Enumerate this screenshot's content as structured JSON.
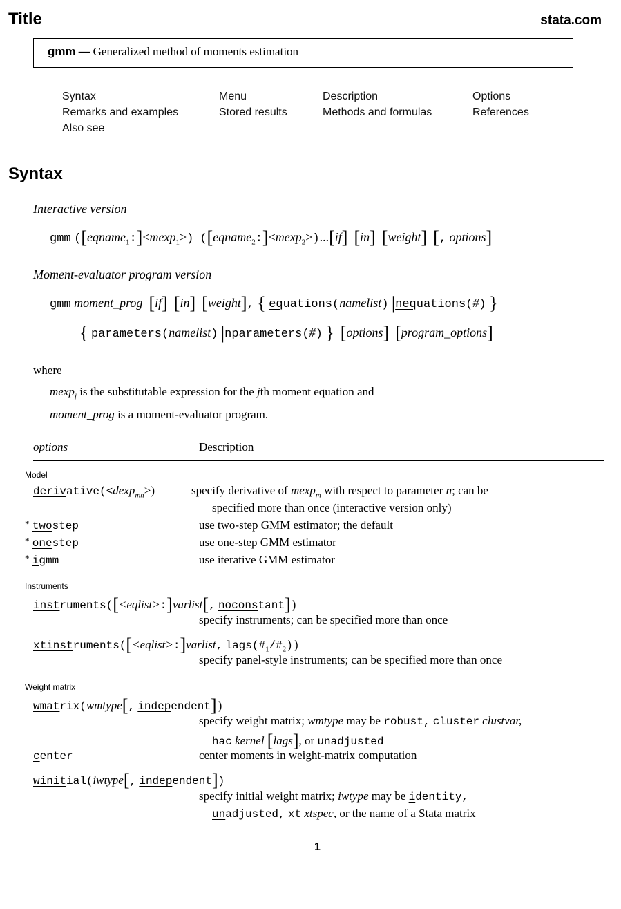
{
  "header": {
    "title": "Title",
    "site": "stata.com"
  },
  "title_box": {
    "command": "gmm",
    "dash": "—",
    "description": "Generalized method of moments estimation"
  },
  "nav_links": [
    {
      "label": "Syntax"
    },
    {
      "label": "Menu"
    },
    {
      "label": "Description"
    },
    {
      "label": "Options"
    },
    {
      "label": "Remarks and examples"
    },
    {
      "label": "Stored results"
    },
    {
      "label": "Methods and formulas"
    },
    {
      "label": "References"
    },
    {
      "label": "Also see"
    }
  ],
  "syntax": {
    "heading": "Syntax",
    "interactive": {
      "label": "Interactive version",
      "cmd": "gmm",
      "eqname1": "eqname",
      "mexp1": "mexp",
      "eqname2": "eqname",
      "mexp2": "mexp",
      "sub1": "1",
      "sub2": "2",
      "ellipsis": "...",
      "if": "if",
      "in": "in",
      "weight": "weight",
      "options": "options"
    },
    "program": {
      "label": "Moment-evaluator program version",
      "cmd": "gmm",
      "moment_prog": "moment_prog",
      "if": "if",
      "in": "in",
      "weight": "weight",
      "eq_ul": "eq",
      "eq_rest": "uations(",
      "namelist": "namelist",
      "neq_ul": "neq",
      "neq_rest": "uations(",
      "hash": "#",
      "param_ul": "param",
      "param_rest": "eters(",
      "nparam_ul": "nparam",
      "nparam_rest": "eters(",
      "options": "options",
      "program_options": "program_options"
    },
    "where": {
      "label": "where",
      "line1_term": "mexp",
      "line1_sub": "j",
      "line1_a": "is the substitutable expression for the",
      "line1_j": "j",
      "line1_b": "th moment equation and",
      "line2_term": "moment_prog",
      "line2_text": "is a moment-evaluator program."
    }
  },
  "options_table": {
    "col1": "options",
    "col2": "Description",
    "groups": [
      {
        "label": "Model"
      },
      {
        "label": "Instruments"
      },
      {
        "label": "Weight matrix"
      }
    ],
    "rows": {
      "derivative": {
        "ul": "deriv",
        "rest": "ative(<",
        "arg": "dexp",
        "sub": "mn",
        "close": ">)",
        "desc_a": "specify derivative of",
        "desc_term": "mexp",
        "desc_sub": "m",
        "desc_b": "with respect to parameter",
        "desc_n": "n",
        "desc_c": "; can be",
        "desc_line2": "specified more than once (interactive version only)"
      },
      "twostep": {
        "star": "*",
        "ul": "two",
        "rest": "step",
        "desc": "use two-step GMM estimator; the default"
      },
      "onestep": {
        "star": "*",
        "ul": "one",
        "rest": "step",
        "desc": "use one-step GMM estimator"
      },
      "igmm": {
        "star": "*",
        "ul": "i",
        "rest": "gmm",
        "desc": "use iterative GMM estimator"
      },
      "instruments": {
        "ul": "inst",
        "rest": "ruments(",
        "eqlist": "<eqlist>",
        "colon": ":",
        "varlist": "varlist",
        "comma": ",",
        "nc_ul": "nocons",
        "nc_rest": "tant",
        "close": ")",
        "desc": "specify instruments; can be specified more than once"
      },
      "xtinstruments": {
        "ul": "xtinst",
        "rest": "ruments(",
        "eqlist": "<eqlist>",
        "colon": ":",
        "varlist": "varlist",
        "lags": "lags(#",
        "s1": "1",
        "slash": "/#",
        "s2": "2",
        "close": "))",
        "desc": "specify panel-style instruments; can be specified more than once"
      },
      "wmatrix": {
        "ul": "wmat",
        "rest": "rix(",
        "arg": "wmtype",
        "ind_ul": "indep",
        "ind_rest": "endent",
        "close": ")",
        "desc_a": "specify weight matrix;",
        "desc_term": "wmtype",
        "desc_b": "may be",
        "r_ul": "r",
        "r_rest": "obust,",
        "cl_ul": "cl",
        "cl_rest": "uster",
        "clustvar": "clustvar,",
        "hac": "hac",
        "kernel": "kernel",
        "lags": "lags",
        "or": ", or",
        "un_ul": "un",
        "un_rest": "adjusted"
      },
      "center": {
        "ul": "c",
        "rest": "enter",
        "desc": "center moments in weight-matrix computation"
      },
      "winitial": {
        "ul": "winit",
        "rest": "ial(",
        "arg": "iwtype",
        "ind_ul": "indep",
        "ind_rest": "endent",
        "close": ")",
        "desc_a": "specify initial weight matrix;",
        "desc_term": "iwtype",
        "desc_b": "may be",
        "i_ul": "i",
        "i_rest": "dentity,",
        "un_ul": "un",
        "un_rest": "adjusted,",
        "xt": "xt",
        "xtspec": "xtspec",
        "desc_c": ", or the name of a Stata matrix"
      }
    }
  },
  "page_number": "1"
}
